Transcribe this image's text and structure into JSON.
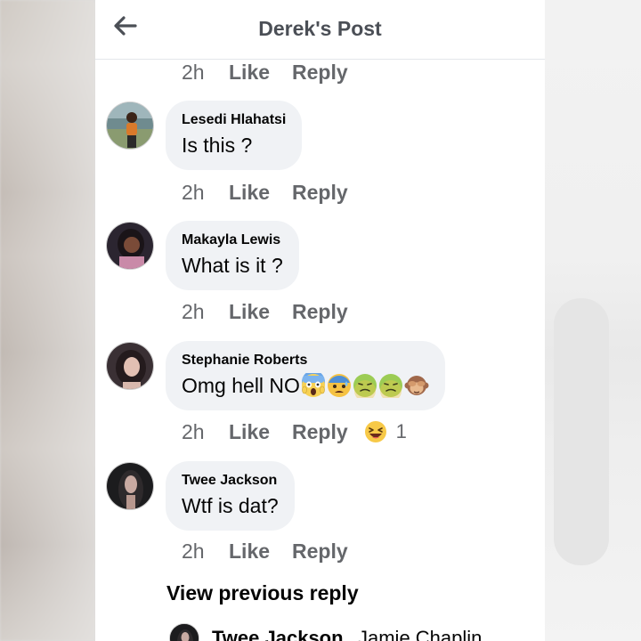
{
  "header": {
    "title": "Derek's Post",
    "back_icon": "arrow-left-icon"
  },
  "top_meta": {
    "time": "2h",
    "like": "Like",
    "reply": "Reply"
  },
  "comments": [
    {
      "author": "Lesedi Hlahatsi",
      "text": "Is this  ?",
      "time": "2h",
      "like": "Like",
      "reply": "Reply"
    },
    {
      "author": "Makayla Lewis",
      "text": "What is it ?",
      "time": "2h",
      "like": "Like",
      "reply": "Reply"
    },
    {
      "author": "Stephanie Roberts",
      "text": "Omg hell NO",
      "emojis": [
        "screaming-face-emoji",
        "anxious-face-emoji",
        "nauseated-face-emoji",
        "nauseated-face-emoji",
        "see-no-evil-monkey-emoji"
      ],
      "time": "2h",
      "like": "Like",
      "reply": "Reply",
      "reaction": {
        "icon": "laughing-face-icon",
        "count": "1"
      }
    },
    {
      "author": "Twee Jackson",
      "text": "Wtf is dat?",
      "time": "2h",
      "like": "Like",
      "reply": "Reply"
    }
  ],
  "view_previous": "View previous reply",
  "reply_preview": {
    "author": "Twee Jackson",
    "text": "Jamie Chaplin"
  },
  "colors": {
    "bubble": "#f0f2f5",
    "meta_text": "#65676b",
    "title_text": "#4b4f56"
  }
}
